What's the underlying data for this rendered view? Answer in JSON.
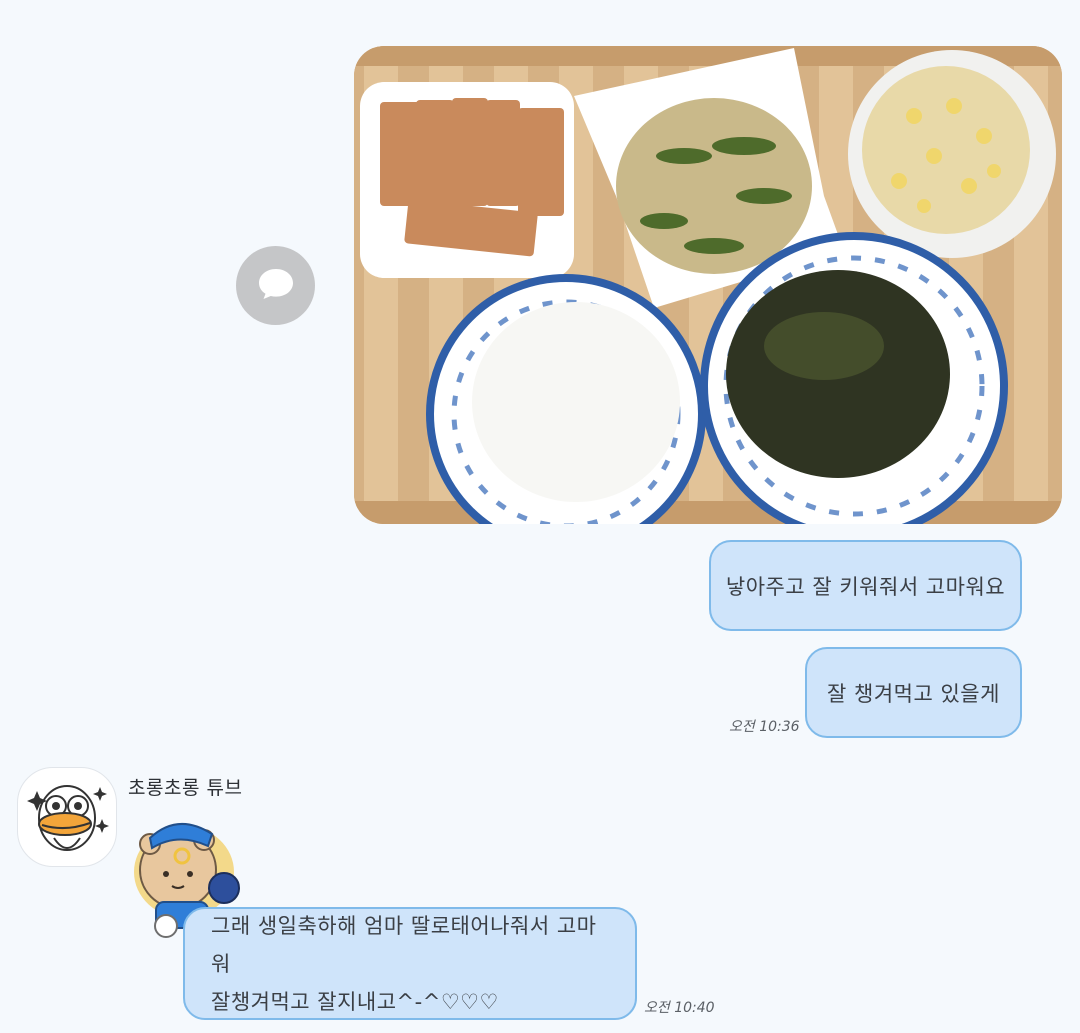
{
  "chat": {
    "outgoing": [
      {
        "text": "낳아주고 잘 키워줘서 고마워요"
      },
      {
        "text": "잘 챙겨먹고 있을게"
      }
    ],
    "outgoing_time": "오전 10:36",
    "incoming": {
      "sender_name": "초롱초롱 튜브",
      "message_line1": "그래 생일축하해 엄마 딸로태어나줘서 고마워",
      "message_line2": "잘챙겨먹고 잘지내고^-^♡♡♡",
      "time": "오전 10:40"
    }
  },
  "icons": {
    "share": "speech-bubble-icon",
    "avatar": "duck-avatar-icon",
    "sticker": "bear-baseball-sticker"
  },
  "colors": {
    "background": "#f5f9fd",
    "bubble_fill": "#cfe4fa",
    "bubble_border": "#7fbaea",
    "share_button": "#c5c6c8"
  }
}
